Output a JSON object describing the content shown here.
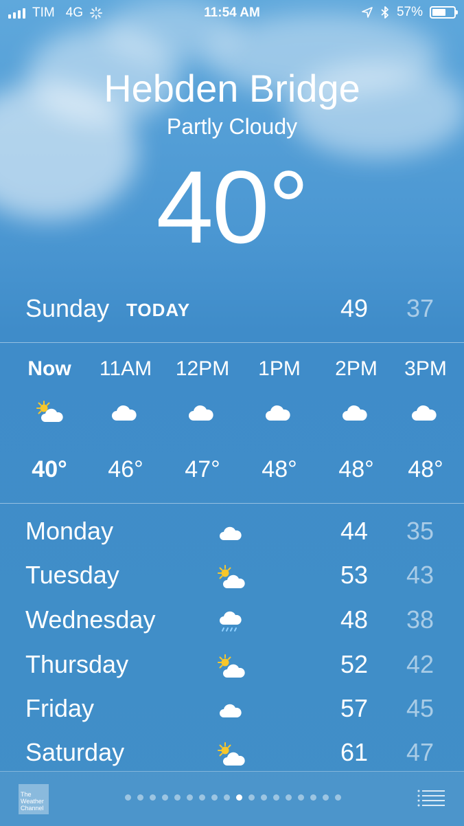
{
  "status_bar": {
    "carrier": "TIM",
    "network": "4G",
    "time": "11:54 AM",
    "battery": "57%",
    "battery_level": 0.57,
    "icons": [
      "signal-bars-icon",
      "loading-spinner-icon",
      "location-arrow-icon",
      "bluetooth-icon",
      "battery-icon"
    ]
  },
  "location": {
    "city": "Hebden Bridge",
    "condition": "Partly Cloudy",
    "temperature": "40°"
  },
  "today": {
    "day": "Sunday",
    "tag": "TODAY",
    "high": "49",
    "low": "37"
  },
  "hourly": [
    {
      "time": "Now",
      "temp": "40°",
      "icon": "partly-sunny-icon"
    },
    {
      "time": "11AM",
      "temp": "46°",
      "icon": "cloud-icon"
    },
    {
      "time": "12PM",
      "temp": "47°",
      "icon": "cloud-icon"
    },
    {
      "time": "1PM",
      "temp": "48°",
      "icon": "cloud-icon"
    },
    {
      "time": "2PM",
      "temp": "48°",
      "icon": "cloud-icon"
    },
    {
      "time": "3PM",
      "temp": "48°",
      "icon": "cloud-icon"
    }
  ],
  "daily": [
    {
      "day": "Monday",
      "high": "44",
      "low": "35",
      "icon": "cloud-icon"
    },
    {
      "day": "Tuesday",
      "high": "53",
      "low": "43",
      "icon": "partly-sunny-icon"
    },
    {
      "day": "Wednesday",
      "high": "48",
      "low": "38",
      "icon": "rain-icon"
    },
    {
      "day": "Thursday",
      "high": "52",
      "low": "42",
      "icon": "partly-sunny-icon"
    },
    {
      "day": "Friday",
      "high": "57",
      "low": "45",
      "icon": "cloud-icon"
    },
    {
      "day": "Saturday",
      "high": "61",
      "low": "47",
      "icon": "partly-sunny-icon"
    }
  ],
  "bottom_bar": {
    "logo_text": "The Weather Channel",
    "page_count": 18,
    "active_page": 10
  },
  "colors": {
    "sky_top": "#5fa8dc",
    "sky_bottom": "#418fc8",
    "sun": "#f7c72b",
    "low_temp": "rgba(255,255,255,0.55)"
  }
}
